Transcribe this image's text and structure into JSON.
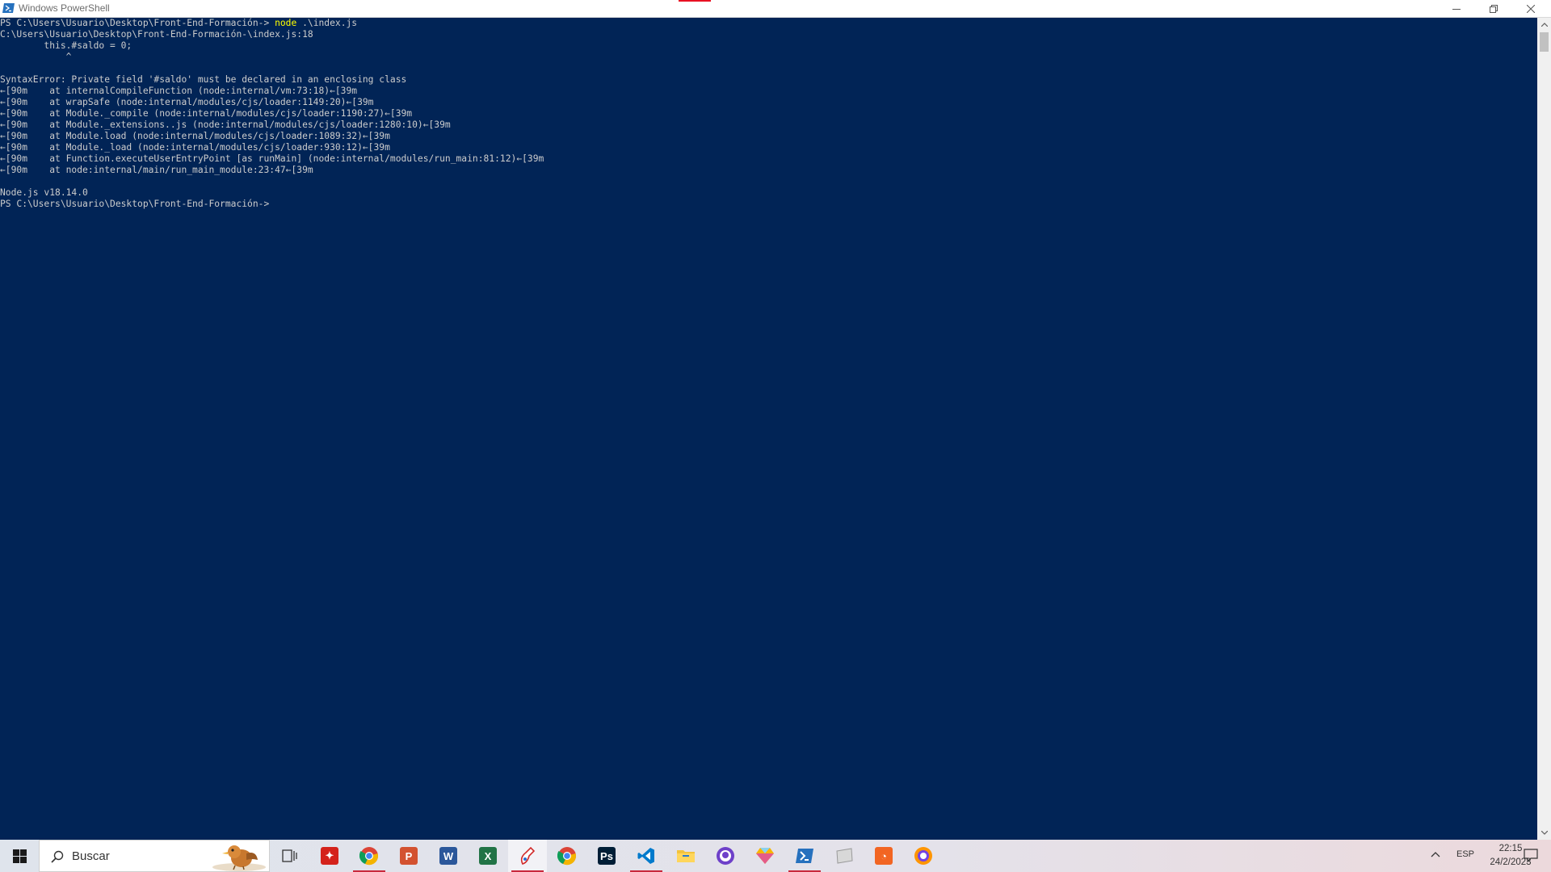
{
  "window": {
    "title": "Windows PowerShell",
    "buttons": {
      "minimize": "minimize",
      "maximize": "restore",
      "close": "close"
    }
  },
  "console": {
    "lines": [
      {
        "prompt": "PS C:\\Users\\Usuario\\Desktop\\Front-End-Formación-> ",
        "command": "node",
        "args": " .\\index.js"
      },
      {
        "text": "C:\\Users\\Usuario\\Desktop\\Front-End-Formación-\\index.js:18"
      },
      {
        "text": "        this.#saldo = 0;"
      },
      {
        "text": "            ^"
      },
      {
        "text": ""
      },
      {
        "text": "SyntaxError: Private field '#saldo' must be declared in an enclosing class"
      },
      {
        "text": "←[90m    at internalCompileFunction (node:internal/vm:73:18)←[39m"
      },
      {
        "text": "←[90m    at wrapSafe (node:internal/modules/cjs/loader:1149:20)←[39m"
      },
      {
        "text": "←[90m    at Module._compile (node:internal/modules/cjs/loader:1190:27)←[39m"
      },
      {
        "text": "←[90m    at Module._extensions..js (node:internal/modules/cjs/loader:1280:10)←[39m"
      },
      {
        "text": "←[90m    at Module.load (node:internal/modules/cjs/loader:1089:32)←[39m"
      },
      {
        "text": "←[90m    at Module._load (node:internal/modules/cjs/loader:930:12)←[39m"
      },
      {
        "text": "←[90m    at Function.executeUserEntryPoint [as runMain] (node:internal/modules/run_main:81:12)←[39m"
      },
      {
        "text": "←[90m    at node:internal/main/run_main_module:23:47←[39m"
      },
      {
        "text": ""
      },
      {
        "text": "Node.js v18.14.0"
      },
      {
        "text": "PS C:\\Users\\Usuario\\Desktop\\Front-End-Formación-> "
      }
    ]
  },
  "taskbar": {
    "search_placeholder": "Buscar",
    "apps": [
      {
        "name": "task-view",
        "icon": "task-view-icon"
      },
      {
        "name": "acrobat",
        "icon": "acrobat-icon",
        "color": "#d4221b"
      },
      {
        "name": "chrome-profile",
        "icon": "chrome-icon",
        "active": true
      },
      {
        "name": "powerpoint",
        "icon": "powerpoint-icon",
        "color": "#d35230",
        "letter": "P"
      },
      {
        "name": "word",
        "icon": "word-icon",
        "color": "#2b579a",
        "letter": "W"
      },
      {
        "name": "excel",
        "icon": "excel-icon",
        "color": "#217346",
        "letter": "X"
      },
      {
        "name": "paint",
        "icon": "paint-icon",
        "active": true,
        "highlighted": true
      },
      {
        "name": "chrome",
        "icon": "chrome-icon"
      },
      {
        "name": "photoshop",
        "icon": "photoshop-icon",
        "color": "#001e36",
        "letter": "Ps"
      },
      {
        "name": "vscode",
        "icon": "vscode-icon",
        "color": "#007acc",
        "active": true
      },
      {
        "name": "file-explorer",
        "icon": "folder-icon",
        "color": "#f3c33c"
      },
      {
        "name": "github-desktop",
        "icon": "github-icon",
        "color": "#6e40c9"
      },
      {
        "name": "sketch-app",
        "icon": "diamond-icon",
        "color": "#f7b500"
      },
      {
        "name": "powershell",
        "icon": "powershell-icon",
        "color": "#2671be",
        "active": true
      },
      {
        "name": "generic-app",
        "icon": "app-icon",
        "color": "#b9b9b9"
      },
      {
        "name": "orange-app",
        "icon": "orange-app-icon",
        "color": "#f26522"
      },
      {
        "name": "firefox-like",
        "icon": "browser-icon",
        "color": "#ff9500"
      }
    ],
    "tray": {
      "language": "ESP",
      "time": "22:15",
      "date": "24/2/2023"
    }
  }
}
